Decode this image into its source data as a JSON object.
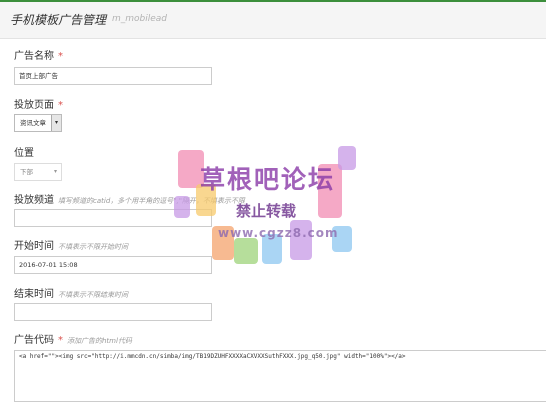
{
  "header": {
    "title": "手机模板广告管理",
    "subtitle": "m_mobilead"
  },
  "form": {
    "ad_name": {
      "label": "广告名称",
      "required": "*",
      "value": "首页上部广告"
    },
    "placement_page": {
      "label": "投放页面",
      "required": "*",
      "selected": "资讯文章",
      "arrow": "▾"
    },
    "position": {
      "label": "位置",
      "selected": "下部",
      "caret": "▾"
    },
    "channel": {
      "label": "投放频道",
      "hint": "填写频道的catid，多个用半角的逗号\",\"隔开，不填表示不限",
      "value": ""
    },
    "start_time": {
      "label": "开始时间",
      "hint": "不填表示不限开始时间",
      "value": "2016-07-01 15:08"
    },
    "end_time": {
      "label": "结束时间",
      "hint": "不填表示不限结束时间",
      "value": ""
    },
    "ad_code": {
      "label": "广告代码",
      "required": "*",
      "hint": "添加广告的html代码",
      "value": "<a href=\"\"><img src=\"http://i.mmcdn.cn/simba/img/TB19DZUHFXXXXaCXVXXSuthFXXX.jpg_q50.jpg\" width=\"100%\"></a>"
    }
  },
  "watermark": {
    "title": "草根吧论坛",
    "subtitle": "禁止转载",
    "url": "www.cgzz8.com",
    "colors": [
      "#f28cb3",
      "#f7c96b",
      "#9ed37a",
      "#8ec7f0",
      "#c79ae6",
      "#f4a36c"
    ]
  }
}
